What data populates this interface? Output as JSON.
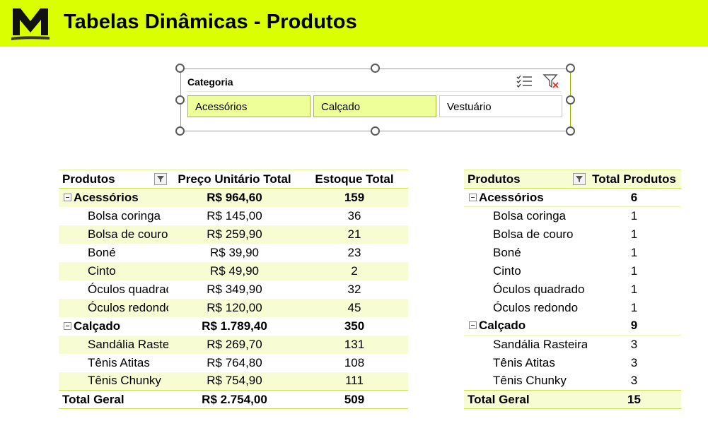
{
  "header": {
    "title": "Tabelas Dinâmicas - Produtos",
    "colors": {
      "banner": "#d9ff00",
      "logo": "#111111"
    }
  },
  "slicer": {
    "title": "Categoria",
    "items": [
      {
        "label": "Acessórios",
        "selected": true
      },
      {
        "label": "Calçado",
        "selected": true
      },
      {
        "label": "Vestuário",
        "selected": false
      }
    ],
    "icons": [
      "multi-select-icon",
      "clear-filter-icon"
    ]
  },
  "pivot1": {
    "headers": [
      "Produtos",
      "Preço Unitário Total",
      "Estoque Total"
    ],
    "groups": [
      {
        "name": "Acessórios",
        "price": "R$ 964,60",
        "stock": "159",
        "items": [
          {
            "name": "Bolsa coringa",
            "price": "R$ 145,00",
            "stock": "36"
          },
          {
            "name": "Bolsa de couro",
            "price": "R$ 259,90",
            "stock": "21"
          },
          {
            "name": "Boné",
            "price": "R$ 39,90",
            "stock": "23"
          },
          {
            "name": "Cinto",
            "price": "R$ 49,90",
            "stock": "2"
          },
          {
            "name": "Óculos quadrado",
            "price": "R$ 349,90",
            "stock": "32"
          },
          {
            "name": "Óculos redondo",
            "price": "R$ 120,00",
            "stock": "45"
          }
        ]
      },
      {
        "name": "Calçado",
        "price": "R$ 1.789,40",
        "stock": "350",
        "items": [
          {
            "name": "Sandália Rasteira",
            "price": "R$ 269,70",
            "stock": "131"
          },
          {
            "name": "Tênis Atitas",
            "price": "R$ 764,80",
            "stock": "108"
          },
          {
            "name": "Tênis Chunky",
            "price": "R$ 754,90",
            "stock": "111"
          }
        ]
      }
    ],
    "total": {
      "label": "Total Geral",
      "price": "R$ 2.754,00",
      "stock": "509"
    }
  },
  "pivot2": {
    "headers": [
      "Produtos",
      "Total Produtos"
    ],
    "groups": [
      {
        "name": "Acessórios",
        "count": "6",
        "items": [
          {
            "name": "Bolsa coringa",
            "count": "1"
          },
          {
            "name": "Bolsa de couro",
            "count": "1"
          },
          {
            "name": "Boné",
            "count": "1"
          },
          {
            "name": "Cinto",
            "count": "1"
          },
          {
            "name": "Óculos quadrado",
            "count": "1"
          },
          {
            "name": "Óculos redondo",
            "count": "1"
          }
        ]
      },
      {
        "name": "Calçado",
        "count": "9",
        "items": [
          {
            "name": "Sandália Rasteira",
            "count": "3"
          },
          {
            "name": "Tênis Atitas",
            "count": "3"
          },
          {
            "name": "Tênis Chunky",
            "count": "3"
          }
        ]
      }
    ],
    "total": {
      "label": "Total Geral",
      "count": "15"
    }
  }
}
